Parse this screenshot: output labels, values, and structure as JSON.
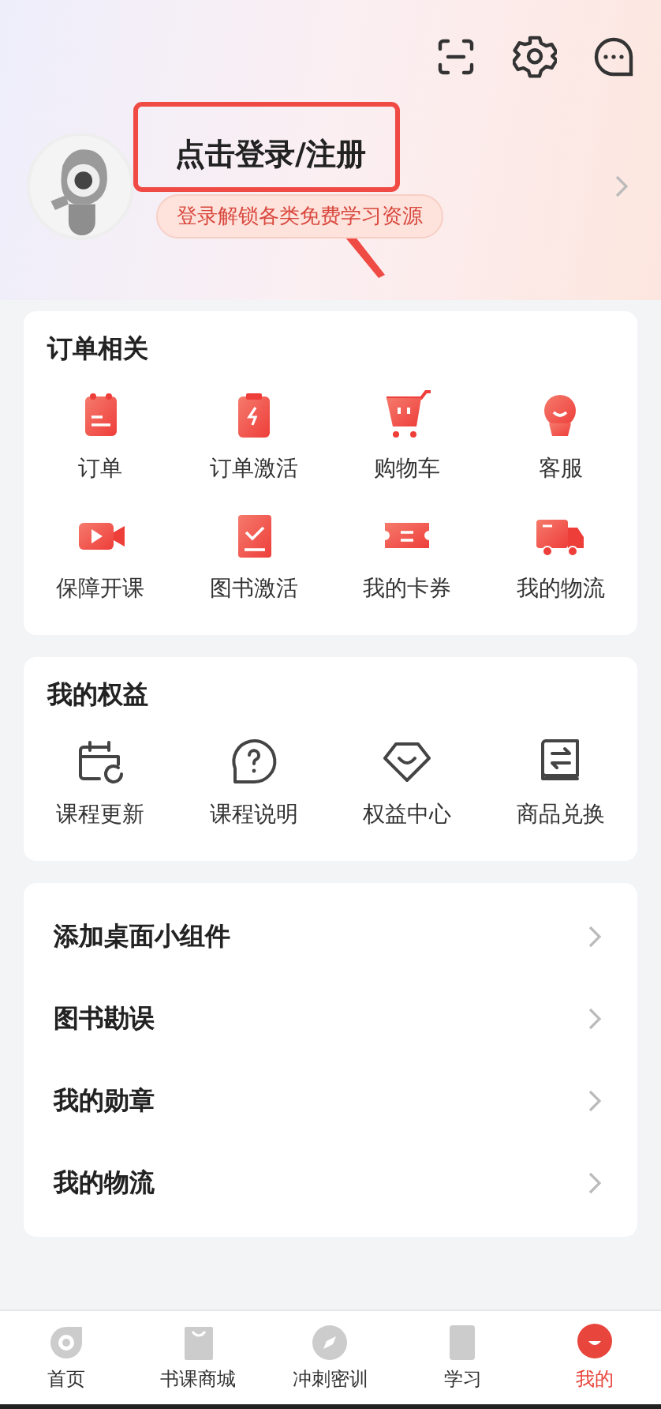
{
  "header": {
    "login_title": "点击登录/注册",
    "login_hint": "登录解锁各类免费学习资源",
    "annotation": {
      "kind": "box-arrow"
    }
  },
  "sections": [
    {
      "title": "订单相关",
      "kind": "filled",
      "items": [
        {
          "label": "订单"
        },
        {
          "label": "订单激活"
        },
        {
          "label": "购物车"
        },
        {
          "label": "客服"
        },
        {
          "label": "保障开课"
        },
        {
          "label": "图书激活"
        },
        {
          "label": "我的卡券"
        },
        {
          "label": "我的物流"
        }
      ]
    },
    {
      "title": "我的权益",
      "kind": "outline",
      "items": [
        {
          "label": "课程更新"
        },
        {
          "label": "课程说明"
        },
        {
          "label": "权益中心"
        },
        {
          "label": "商品兑换"
        }
      ]
    }
  ],
  "menu": [
    {
      "label": "添加桌面小组件"
    },
    {
      "label": "图书勘误"
    },
    {
      "label": "我的勋章"
    },
    {
      "label": "我的物流"
    }
  ],
  "tabs": [
    {
      "label": "首页",
      "selected": false
    },
    {
      "label": "书课商城",
      "selected": false
    },
    {
      "label": "冲刺密训",
      "selected": false
    },
    {
      "label": "学习",
      "selected": false
    },
    {
      "label": "我的",
      "selected": true
    }
  ]
}
